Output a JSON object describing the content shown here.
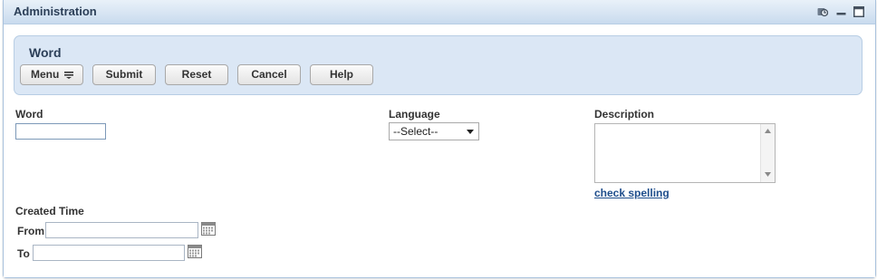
{
  "window": {
    "title": "Administration",
    "controls": [
      "refresh-icon",
      "minimize-icon",
      "maximize-icon"
    ]
  },
  "form": {
    "title": "Word"
  },
  "toolbar": {
    "menu_label": "Menu",
    "submit_label": "Submit",
    "reset_label": "Reset",
    "cancel_label": "Cancel",
    "help_label": "Help"
  },
  "fields": {
    "word": {
      "label": "Word",
      "value": ""
    },
    "language": {
      "label": "Language",
      "selected": "--Select--"
    },
    "description": {
      "label": "Description",
      "value": "",
      "spell_link": "check spelling"
    },
    "created_time": {
      "label": "Created Time",
      "from_label": "From",
      "from_value": "",
      "to_label": "To",
      "to_value": ""
    }
  },
  "colors": {
    "title_text": "#2c3f58",
    "panel_bg": "#dbe7f5",
    "link": "#1f4e8c"
  }
}
